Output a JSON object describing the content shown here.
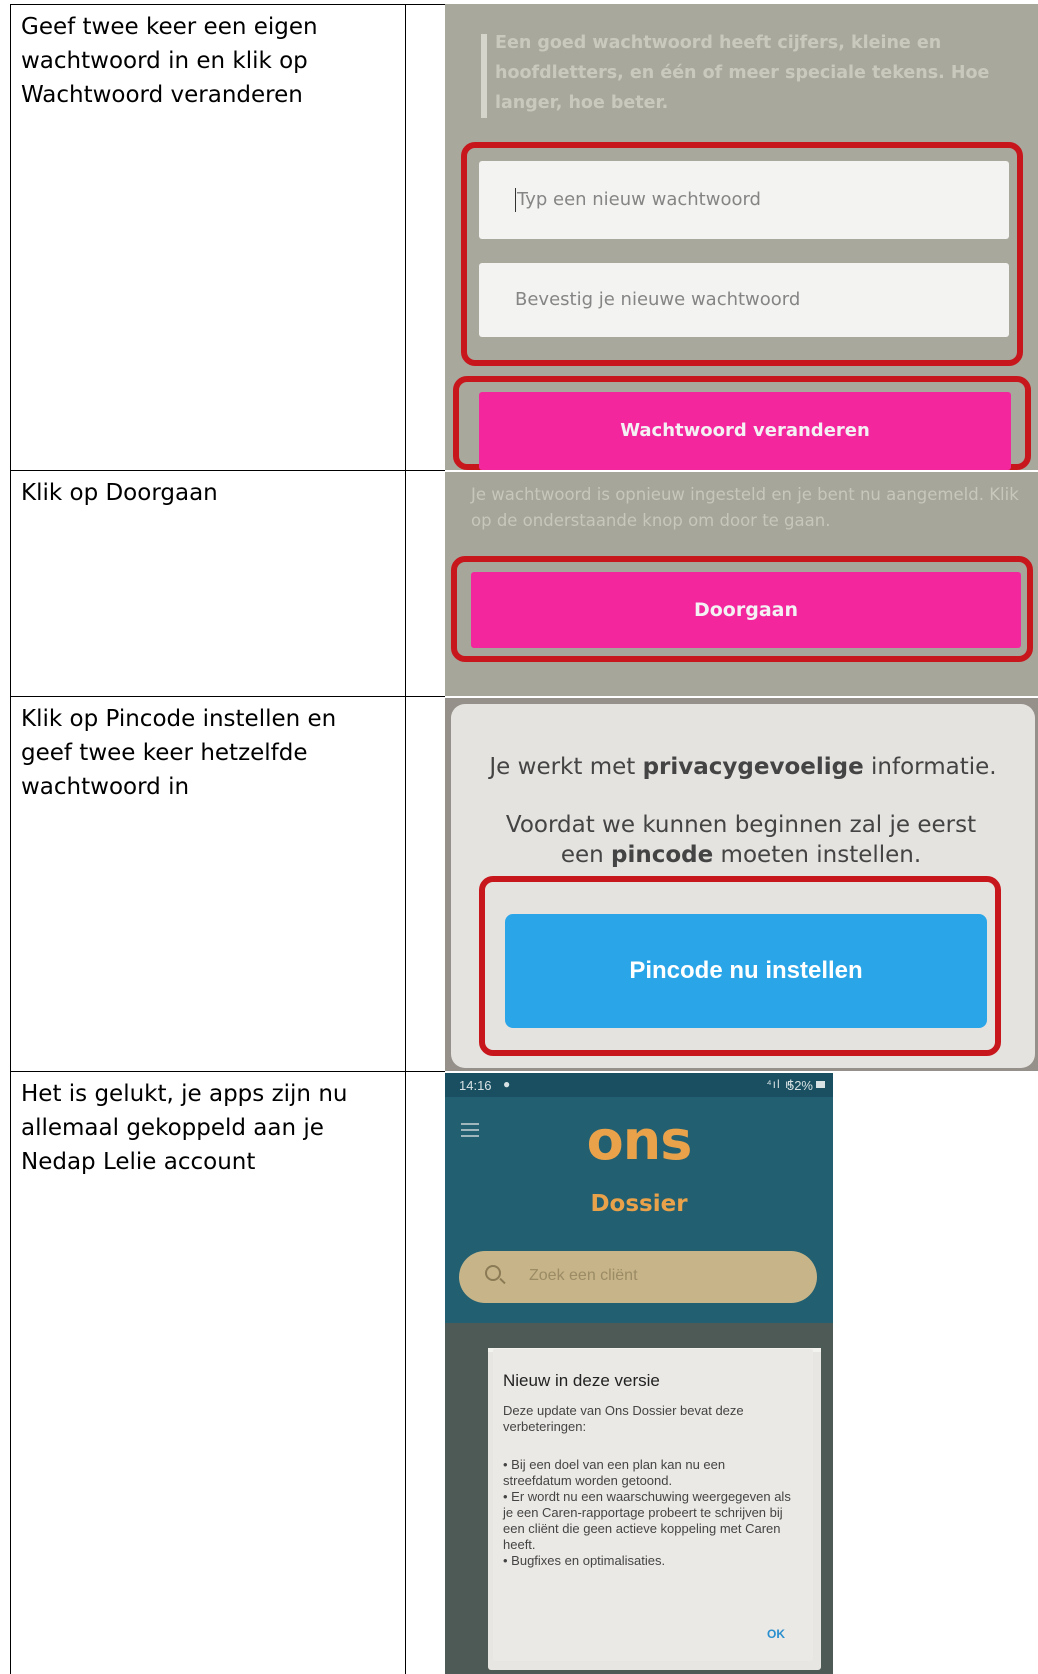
{
  "rows": [
    {
      "instruction": "Geef twee keer een eigen wachtwoord in en klik op Wachtwoord veranderen"
    },
    {
      "instruction": "Klik op Doorgaan"
    },
    {
      "instruction": "Klik op Pincode instellen en geef twee keer hetzelfde wachtwoord in"
    },
    {
      "instruction": "Het is gelukt, je apps zijn nu allemaal gekoppeld aan je Nedap Lelie account"
    }
  ],
  "shot1": {
    "hint": "Een goed wachtwoord heeft cijfers, kleine en hoofdletters, en één of meer speciale tekens. Hoe langer, hoe beter.",
    "new_password_placeholder": "Typ een nieuw wachtwoord",
    "confirm_password_placeholder": "Bevestig je nieuwe wachtwoord",
    "button": "Wachtwoord veranderen"
  },
  "shot2": {
    "note": "Je wachtwoord is opnieuw ingesteld en je bent nu aangemeld. Klik op de onderstaande knop om door te gaan.",
    "button": "Doorgaan"
  },
  "shot3": {
    "line1_a": "Je werkt met ",
    "line1_bold": "privacygevoelige",
    "line1_b": " informatie.",
    "line2_a": "Voordat we kunnen beginnen zal je eerst een ",
    "line2_bold": "pincode",
    "line2_b": " moeten instellen.",
    "button": "Pincode nu instellen"
  },
  "shot4": {
    "time": "14:16",
    "battery": "52%",
    "logo": "ons",
    "subtitle": "Dossier",
    "search_placeholder": "Zoek een cliënt",
    "dialog_title": "Nieuw in deze versie",
    "dialog_intro": "Deze update van Ons Dossier bevat deze verbeteringen:",
    "dialog_items": [
      "• Bij een doel van een plan kan nu een streefdatum worden getoond.",
      "• Er wordt nu een waarschuwing weergegeven als je een Caren-rapportage probeert te schrijven bij een cliënt die geen actieve koppeling met Caren heeft.",
      "• Bugfixes en optimalisaties."
    ],
    "ok": "OK"
  },
  "colors": {
    "highlight_red": "#c8161d",
    "pink_button": "#f3269e",
    "blue_button": "#2aa6e8",
    "ons_orange": "#e9a24a",
    "ons_teal": "#205d6f"
  }
}
